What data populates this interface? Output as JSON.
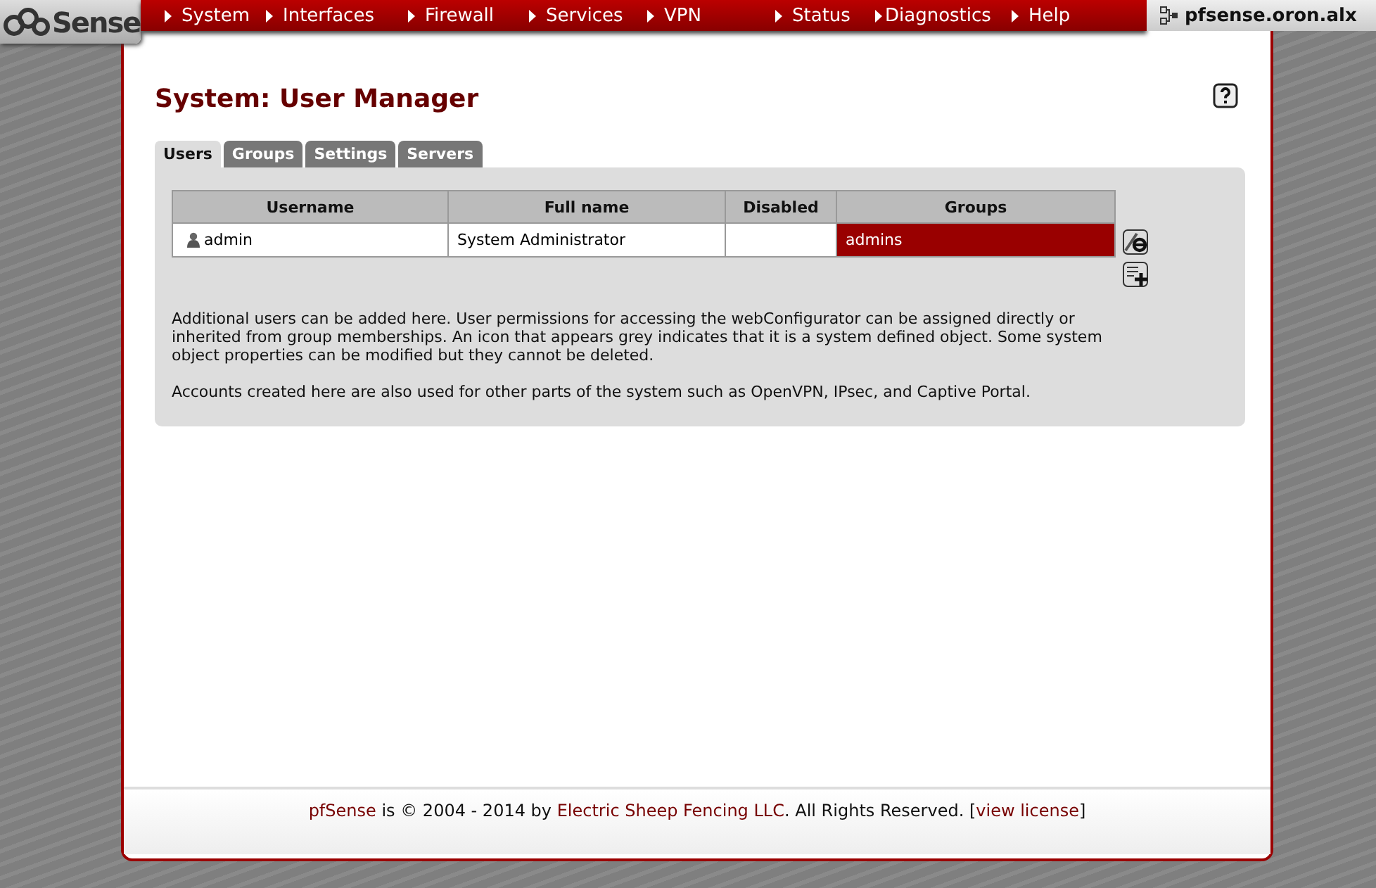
{
  "logo": {
    "text": "Sense"
  },
  "menu": [
    {
      "label": "System"
    },
    {
      "label": "Interfaces"
    },
    {
      "label": "Firewall"
    },
    {
      "label": "Services"
    },
    {
      "label": "VPN"
    },
    {
      "label": "Status"
    },
    {
      "label": "Diagnostics"
    },
    {
      "label": "Help"
    }
  ],
  "hostname": "pfsense.oron.alx",
  "page_title": "System: User Manager",
  "tabs": [
    {
      "label": "Users",
      "selected": true
    },
    {
      "label": "Groups",
      "selected": false
    },
    {
      "label": "Settings",
      "selected": false
    },
    {
      "label": "Servers",
      "selected": false
    }
  ],
  "table": {
    "columns": [
      "Username",
      "Full name",
      "Disabled",
      "Groups"
    ],
    "rows": [
      {
        "username": "admin",
        "full_name": "System Administrator",
        "groups": "admins",
        "groups_highlighted": true
      }
    ]
  },
  "notes": [
    "Additional users can be added here. User permissions for accessing the webConfigurator can be assigned directly or inherited from group memberships. An icon that appears grey indicates that it is a system defined object. Some system object properties can be modified but they cannot be deleted.",
    "Accounts created here are also used for other parts of the system such as OpenVPN, IPsec, and Captive Portal."
  ],
  "footer": [
    {
      "kind": "link",
      "text": "pfSense"
    },
    {
      "kind": "text",
      "text": " is © 2004 - 2014 by "
    },
    {
      "kind": "link",
      "text": "Electric Sheep Fencing LLC"
    },
    {
      "kind": "text",
      "text": ". All Rights Reserved. ["
    },
    {
      "kind": "link",
      "text": "view license"
    },
    {
      "kind": "text",
      "text": "]"
    }
  ]
}
